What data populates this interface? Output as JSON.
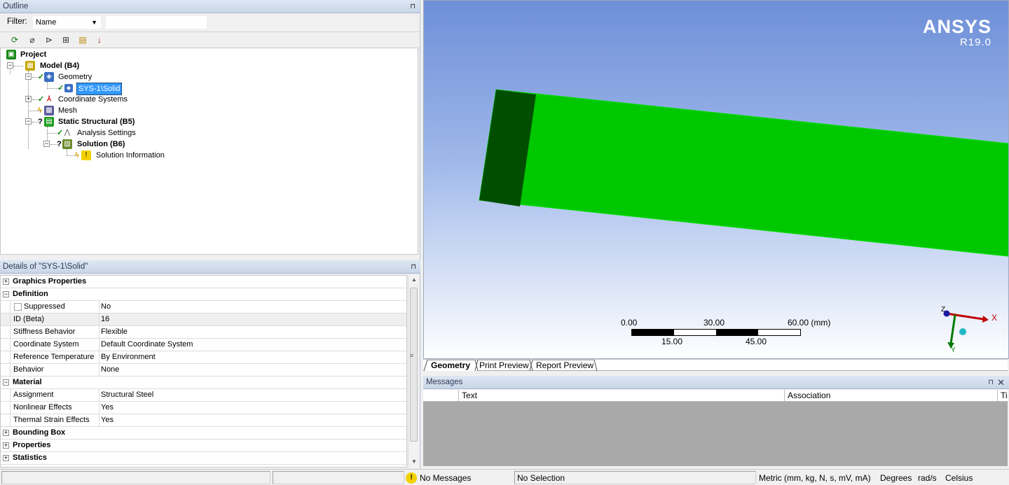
{
  "outline": {
    "title": "Outline",
    "filter_label": "Filter:",
    "filter_value": "Name",
    "toolbar_icons": [
      "refresh-icon",
      "clear-icon",
      "tree-expand-icon",
      "plus-icon",
      "folder-icon",
      "sort-icon"
    ],
    "tree": {
      "project": "Project",
      "model": "Model (B4)",
      "geometry": "Geometry",
      "solid": "SYS-1\\Solid",
      "coord": "Coordinate Systems",
      "mesh": "Mesh",
      "static": "Static Structural (B5)",
      "analysis": "Analysis Settings",
      "solution": "Solution (B6)",
      "solinfo": "Solution Information"
    }
  },
  "details": {
    "title": "Details of \"SYS-1\\Solid\"",
    "groups": {
      "graphics": "Graphics Properties",
      "definition": "Definition",
      "material": "Material",
      "bounding": "Bounding Box",
      "properties": "Properties",
      "statistics": "Statistics"
    },
    "rows": {
      "suppressed_k": "Suppressed",
      "suppressed_v": "No",
      "id_k": "ID (Beta)",
      "id_v": "16",
      "stiff_k": "Stiffness Behavior",
      "stiff_v": "Flexible",
      "coord_k": "Coordinate System",
      "coord_v": "Default Coordinate System",
      "reftemp_k": "Reference Temperature",
      "reftemp_v": "By Environment",
      "behavior_k": "Behavior",
      "behavior_v": "None",
      "assign_k": "Assignment",
      "assign_v": "Structural Steel",
      "nonlin_k": "Nonlinear Effects",
      "nonlin_v": "Yes",
      "thermal_k": "Thermal Strain Effects",
      "thermal_v": "Yes"
    }
  },
  "viewport": {
    "logo_name": "ANSYS",
    "logo_version": "R19.0",
    "scale": {
      "top_labels": [
        "0.00",
        "30.00",
        "60.00 (mm)"
      ],
      "bottom_labels": [
        "15.00",
        "45.00"
      ]
    },
    "triad": {
      "x": "X",
      "y": "Y",
      "z": "Z"
    },
    "colors": {
      "solid_main": "#00c800",
      "solid_face": "#004f00"
    }
  },
  "tabs": {
    "geometry": "Geometry",
    "print": "Print Preview",
    "report": "Report Preview"
  },
  "messages": {
    "title": "Messages",
    "col_text": "Text",
    "col_assoc": "Association",
    "col_time": "Ti"
  },
  "status": {
    "messages": "No Messages",
    "selection": "No Selection",
    "units": "Metric (mm, kg, N, s, mV, mA)",
    "angle": "Degrees",
    "rate": "rad/s",
    "temp": "Celsius"
  }
}
